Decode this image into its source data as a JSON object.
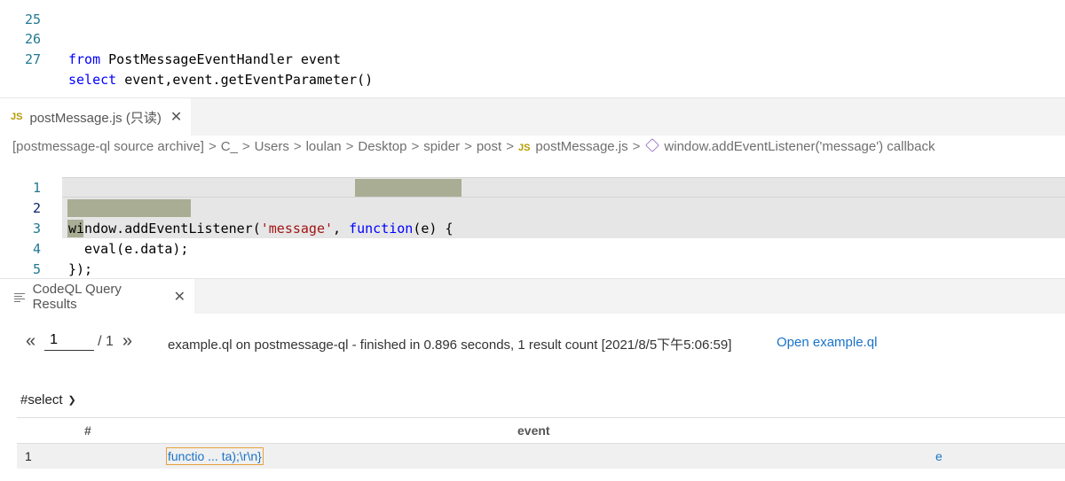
{
  "top_editor": {
    "lines": [
      {
        "num": "26",
        "kw": "from",
        "rest": " PostMessageEventHandler event"
      },
      {
        "num": "27",
        "kw": "select",
        "rest": " event,event.getEventParameter()"
      }
    ]
  },
  "file_tab": {
    "icon": "JS",
    "label": "postMessage.js (只读)",
    "close": "✕"
  },
  "breadcrumb": {
    "items": [
      "[postmessage-ql source archive]",
      "C_",
      "Users",
      "loulan",
      "Desktop",
      "spider",
      "post"
    ],
    "file_icon": "JS",
    "file": "postMessage.js",
    "symbol": "window.addEventListener('message') callback",
    "separator": ">"
  },
  "editor2": {
    "line_numbers": [
      "1",
      "2",
      "3",
      "4",
      "5"
    ],
    "line2_a": "window.addEventListener(",
    "line2_str": "'message'",
    "line2_b": ", ",
    "line2_kw": "function",
    "line2_c": "(e) {",
    "line3": "  eval(e.data);",
    "line4": "});"
  },
  "results_tab": {
    "label": "CodeQL Query Results",
    "close": "✕"
  },
  "pager": {
    "prev": "«",
    "page": "1",
    "total": "/ 1",
    "next": "»"
  },
  "status": "example.ql on postmessage-ql - finished in 0.896 seconds, 1 result count [2021/8/5下午5:06:59]",
  "open_link": "Open example.ql",
  "select_label": "#select",
  "table": {
    "headers": [
      "#",
      "event"
    ],
    "rows": [
      {
        "num": "1",
        "event": "functio ... ta);\\r\\n}",
        "extra": "e"
      }
    ]
  }
}
